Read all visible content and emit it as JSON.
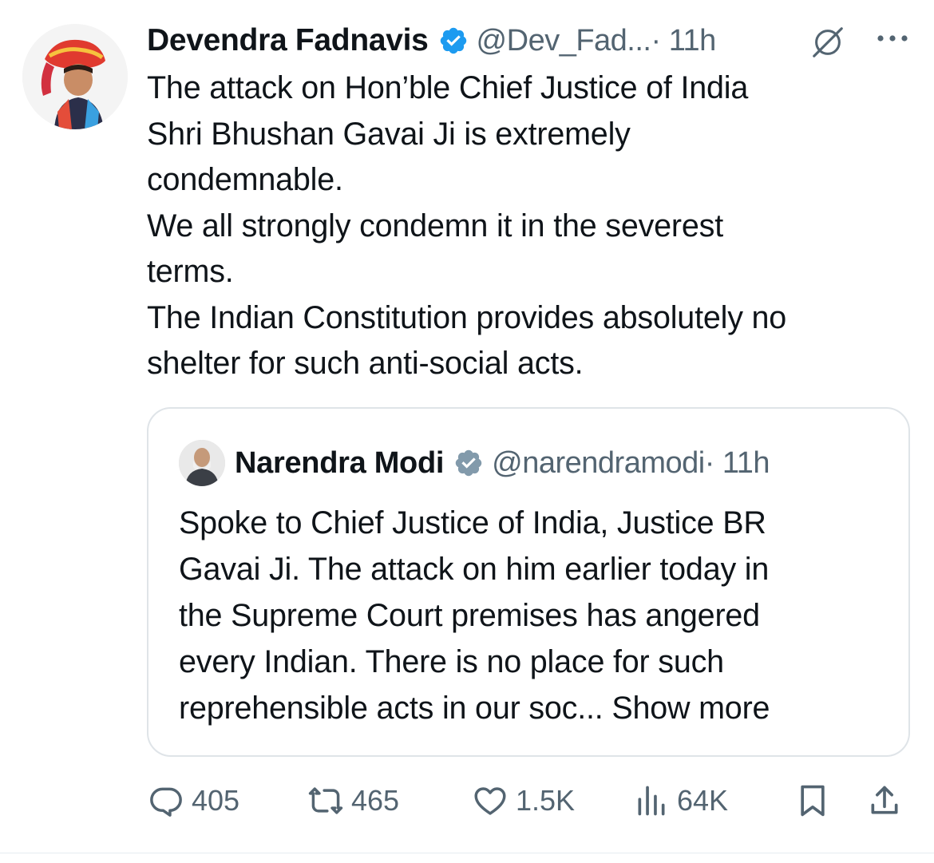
{
  "tweet": {
    "author_name": "Devendra Fadnavis",
    "handle": "@Dev_Fad...",
    "time": "· 11h",
    "lines": [
      "The attack on Hon’ble Chief Justice of India",
      "Shri Bhushan Gavai Ji is extremely",
      "condemnable.",
      "We all strongly condemn it in the severest",
      "terms.",
      "The Indian Constitution provides absolutely no",
      "shelter for such anti-social acts."
    ]
  },
  "quote": {
    "author_name": "Narendra Modi",
    "handle": "@narendramodi",
    "time": "· 11h",
    "lines": [
      "Spoke to Chief Justice of India, Justice BR",
      "Gavai Ji. The attack on him earlier today in",
      "the Supreme Court premises has angered",
      "every Indian. There is no place for such",
      "reprehensible acts in our soc..."
    ],
    "show_more": "Show more"
  },
  "actions": {
    "replies": "405",
    "reposts": "465",
    "likes": "1.5K",
    "views": "64K"
  },
  "icons": {
    "verified": "verified-badge-icon",
    "grok": "grok-icon",
    "more": "more-icon",
    "reply": "reply-icon",
    "repost": "repost-icon",
    "like": "like-icon",
    "views": "views-icon",
    "bookmark": "bookmark-icon",
    "share": "share-icon"
  },
  "colors": {
    "verified_blue": "#1d9bf0",
    "quote_verified_gray": "#829aab",
    "secondary_text": "#536471",
    "accent_link": "#1d9bf0"
  }
}
